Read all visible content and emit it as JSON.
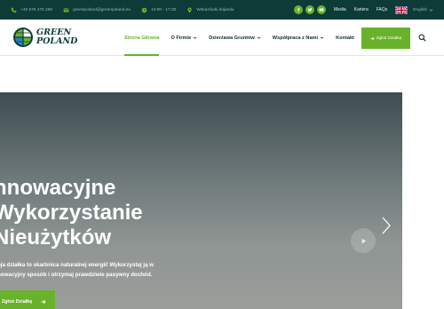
{
  "topbar": {
    "phone": "+48 575 475 290",
    "email": "greenpoland@greenpoland.eu",
    "hours": "10:00 - 17:30",
    "location": "Wskazówki dojazdu",
    "links": [
      "Media",
      "Kariera",
      "FAQs"
    ],
    "language": "English",
    "social": [
      "facebook-icon",
      "twitter-icon",
      "youtube-icon"
    ]
  },
  "header": {
    "logo_line1": "GREEN",
    "logo_line2": "POLAND",
    "nav": [
      {
        "label": "Strona Główna",
        "active": true
      },
      {
        "label": "O Firmie",
        "dropdown": true
      },
      {
        "label": "Dzierżawa Gruntów",
        "dropdown": true
      },
      {
        "label": "Współpraca z Nami",
        "dropdown": true
      },
      {
        "label": "Kontakt"
      }
    ],
    "cta_label": "Zgłoś Działkę"
  },
  "hero": {
    "title_lines": [
      "nnowacyjne",
      "Wykorzystanie",
      "Nieużytków"
    ],
    "sub_lines": [
      "oja działka to skarbnica naturalnej energii! Wykorzystaj ją w",
      "nowacyjny sposób i otrzymaj prawdziwie pasywny dochód."
    ],
    "button_label": "Zgłoś Działkę"
  },
  "colors": {
    "accent": "#69b22c",
    "topbar_bg": "#0d3b37",
    "nav_text": "#0d2e2b"
  }
}
